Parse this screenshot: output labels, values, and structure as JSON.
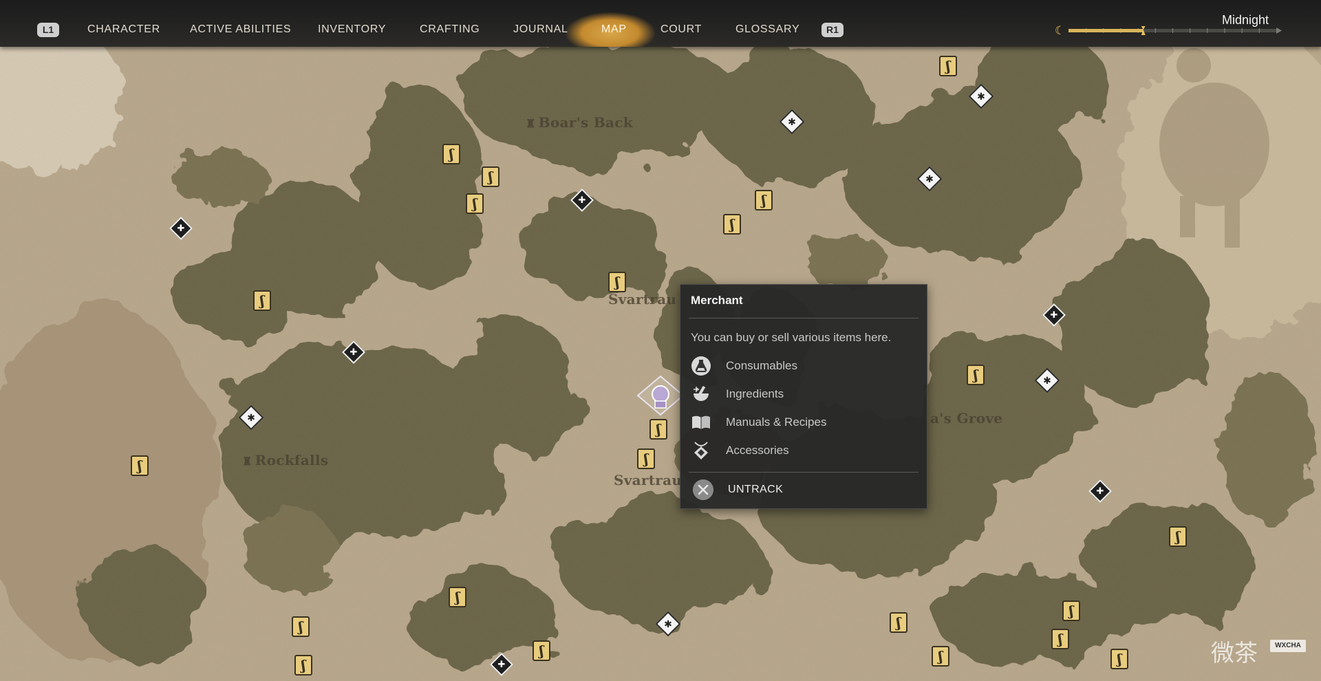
{
  "nav": {
    "left_button": "L1",
    "right_button": "R1",
    "tabs": [
      {
        "id": "character",
        "label": "CHARACTER"
      },
      {
        "id": "active-abilities",
        "label": "ACTIVE ABILITIES"
      },
      {
        "id": "inventory",
        "label": "INVENTORY"
      },
      {
        "id": "crafting",
        "label": "CRAFTING"
      },
      {
        "id": "journal",
        "label": "JOURNAL"
      },
      {
        "id": "map",
        "label": "MAP"
      },
      {
        "id": "court",
        "label": "COURT"
      },
      {
        "id": "glossary",
        "label": "GLOSSARY"
      }
    ],
    "active_tab": "map"
  },
  "time_of_day": {
    "label": "Midnight",
    "progress": 0.36,
    "icon": "crescent-moon-icon"
  },
  "map": {
    "places": [
      {
        "name": "Boar's Back"
      },
      {
        "name": "Svartrau"
      },
      {
        "name": "Rockfalls"
      },
      {
        "name": "Svartrau"
      },
      {
        "name": "a's Grove"
      }
    ],
    "markers": {
      "merchant_icon": "merchant-sign-icon",
      "waypoint_icon": "waypoint-diamond-icon",
      "spider_icon": "spider-lair-icon"
    }
  },
  "tooltip": {
    "title": "Merchant",
    "description": "You can buy or sell various items here.",
    "items": [
      {
        "label": "Consumables",
        "icon": "potion-flask-icon"
      },
      {
        "label": "Ingredients",
        "icon": "mortar-pestle-icon"
      },
      {
        "label": "Manuals & Recipes",
        "icon": "open-book-icon"
      },
      {
        "label": "Accessories",
        "icon": "amulet-icon"
      }
    ],
    "action": {
      "label": "UNTRACK",
      "icon": "cross-button-icon"
    }
  },
  "watermark": {
    "text": "微茶",
    "badge": "WXCHA"
  },
  "colors": {
    "map_light": "#b9a88c",
    "map_dark": "#676244",
    "tab_highlight": "#c8903a",
    "merchant_fill": "#e8cc7e",
    "tooltip_bg": "#282828"
  }
}
